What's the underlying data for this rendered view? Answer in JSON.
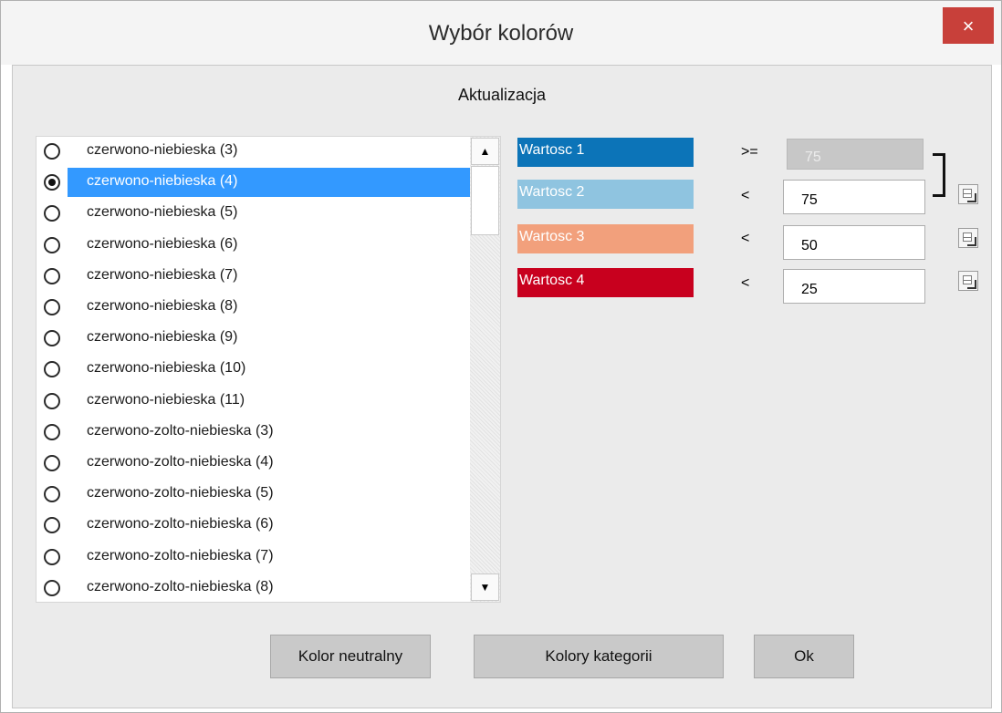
{
  "window": {
    "title": "Wybór kolorów",
    "close_label": "×"
  },
  "section_title": "Aktualizacja",
  "list": {
    "selected_index": 1,
    "items": [
      "czerwono-niebieska (3)",
      "czerwono-niebieska (4)",
      "czerwono-niebieska (5)",
      "czerwono-niebieska (6)",
      "czerwono-niebieska (7)",
      "czerwono-niebieska (8)",
      "czerwono-niebieska (9)",
      "czerwono-niebieska (10)",
      "czerwono-niebieska (11)",
      "czerwono-zolto-niebieska (3)",
      "czerwono-zolto-niebieska (4)",
      "czerwono-zolto-niebieska (5)",
      "czerwono-zolto-niebieska (6)",
      "czerwono-zolto-niebieska (7)",
      "czerwono-zolto-niebieska (8)"
    ],
    "scroll_up_icon": "▲",
    "scroll_down_icon": "▼"
  },
  "values": [
    {
      "label": "Wartosc 1",
      "color": "#0c74b8",
      "operator": ">=",
      "value": "75",
      "disabled": true
    },
    {
      "label": "Wartosc 2",
      "color": "#8fc4e0",
      "operator": "<",
      "value": "75",
      "disabled": false
    },
    {
      "label": "Wartosc 3",
      "color": "#f2a07c",
      "operator": "<",
      "value": "50",
      "disabled": false
    },
    {
      "label": "Wartosc 4",
      "color": "#c8001e",
      "operator": "<",
      "value": "25",
      "disabled": false
    }
  ],
  "buttons": {
    "neutral": "Kolor neutralny",
    "categories": "Kolory kategorii",
    "ok": "Ok"
  }
}
